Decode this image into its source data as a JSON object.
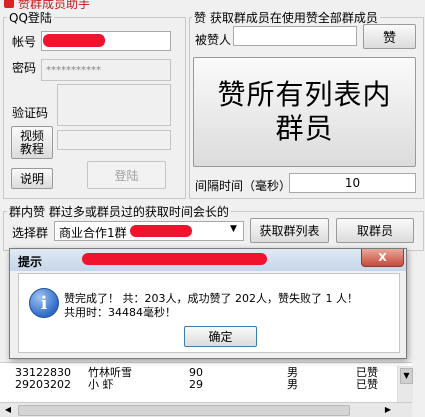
{
  "window": {
    "title": "赞群成员助手"
  },
  "login_group": {
    "title": "QQ登陆",
    "account_label": "帐号",
    "password_label": "密码",
    "password_value": "***********",
    "captcha_label": "验证码",
    "video_button": "视频\n教程",
    "help_button": "说明",
    "login_button": "登陆"
  },
  "like_group": {
    "title": "赞  获取群成员在使用赞全部群成员",
    "target_label": "被赞人",
    "target_value": "",
    "like_button": "赞",
    "like_all_button": "赞所有列表内\n群员",
    "interval_label": "间隔时间（毫秒）",
    "interval_value": "10"
  },
  "group_section": {
    "title": "群内赞  群过多或群员过的获取时间会长的",
    "select_label": "选择群",
    "selected_group": "商业合作1群",
    "fetch_list_button": "获取群列表",
    "fetch_members_button": "取群员"
  },
  "dialog": {
    "title": "提示",
    "close_label": "X",
    "line1": "赞完成了！ 共：203人，成功赞了 202人，赞失败了 1 人！",
    "line2": "共用时：34484毫秒！",
    "ok_button": "确定"
  },
  "table": {
    "rows": [
      {
        "qq": "33122830",
        "name": "竹林听雪",
        "age": "90",
        "gender": "男",
        "status": "已赞"
      },
      {
        "qq": "29203202",
        "name": "小 虾",
        "age": "29",
        "gender": "男",
        "status": "已赞"
      }
    ]
  },
  "colors": {
    "redaction": "#f0132e",
    "title_accent": "#c41818"
  }
}
